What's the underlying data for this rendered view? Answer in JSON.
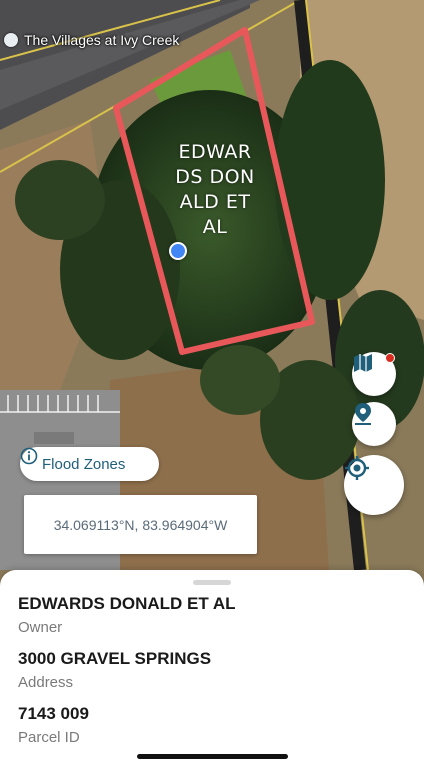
{
  "map": {
    "place_label": "The Villages at Ivy Creek",
    "parcel_name": "EDWAR\nDS DON\nALD ET\nAL",
    "parcel_outline_color": "#e8585a",
    "user_location_color": "#4285f4"
  },
  "controls": {
    "layers_icon": "map-layers-icon",
    "pin_icon": "location-pin-icon",
    "locate_icon": "my-location-icon",
    "icon_color": "#1f5f7a",
    "notification_color": "#d92d20"
  },
  "flood_chip": {
    "label": "Flood Zones",
    "icon": "info-icon"
  },
  "coordinates": {
    "text": "34.069113°N, 83.964904°W"
  },
  "sheet": {
    "owner_value": "EDWARDS DONALD ET AL",
    "owner_label": "Owner",
    "address_value": "3000 GRAVEL SPRINGS",
    "address_label": "Address",
    "parcel_value": "7143 009",
    "parcel_label": "Parcel ID"
  }
}
